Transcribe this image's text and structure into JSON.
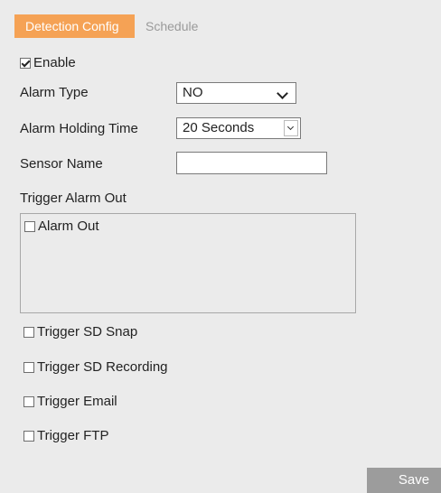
{
  "tabs": [
    {
      "label": "Detection Config",
      "active": true
    },
    {
      "label": "Schedule",
      "active": false
    }
  ],
  "enable": {
    "label": "Enable",
    "checked": true
  },
  "alarm_type": {
    "label": "Alarm Type",
    "value": "NO"
  },
  "alarm_holding_time": {
    "label": "Alarm Holding Time",
    "value": "20 Seconds"
  },
  "sensor_name": {
    "label": "Sensor Name",
    "value": ""
  },
  "trigger_alarm_out": {
    "label": "Trigger Alarm Out",
    "items": [
      {
        "label": "Alarm Out",
        "checked": false
      }
    ]
  },
  "triggers": [
    {
      "label": "Trigger SD Snap",
      "checked": false
    },
    {
      "label": "Trigger SD Recording",
      "checked": false
    },
    {
      "label": "Trigger Email",
      "checked": false
    },
    {
      "label": "Trigger FTP",
      "checked": false
    }
  ],
  "save_label": "Save",
  "colors": {
    "accent": "#f5a255",
    "background": "#ebebeb",
    "save_button": "#9c9c9c"
  }
}
